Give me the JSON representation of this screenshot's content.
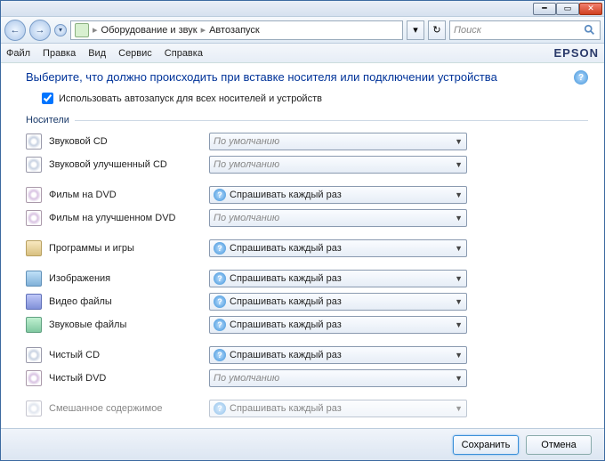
{
  "breadcrumb": {
    "item1": "Оборудование и звук",
    "item2": "Автозапуск"
  },
  "search": {
    "placeholder": "Поиск"
  },
  "menu": {
    "file": "Файл",
    "edit": "Правка",
    "view": "Вид",
    "service": "Сервис",
    "help": "Справка",
    "brand": "EPSON"
  },
  "heading": "Выберите, что должно происходить при вставке носителя или подключении устройства",
  "use_autoplay_label": "Использовать автозапуск для всех носителей и устройств",
  "section_media": "Носители",
  "defaults": {
    "default": "По умолчанию",
    "ask": "Спрашивать каждый раз"
  },
  "rows": {
    "audio_cd": "Звуковой CD",
    "enhanced_audio_cd": "Звуковой улучшенный CD",
    "dvd_movie": "Фильм на DVD",
    "enhanced_dvd_movie": "Фильм на улучшенном DVD",
    "software_games": "Программы и игры",
    "pictures": "Изображения",
    "video_files": "Видео файлы",
    "audio_files": "Звуковые файлы",
    "blank_cd": "Чистый CD",
    "blank_dvd": "Чистый DVD",
    "mixed": "Смешанное содержимое"
  },
  "footer": {
    "save": "Сохранить",
    "cancel": "Отмена"
  }
}
